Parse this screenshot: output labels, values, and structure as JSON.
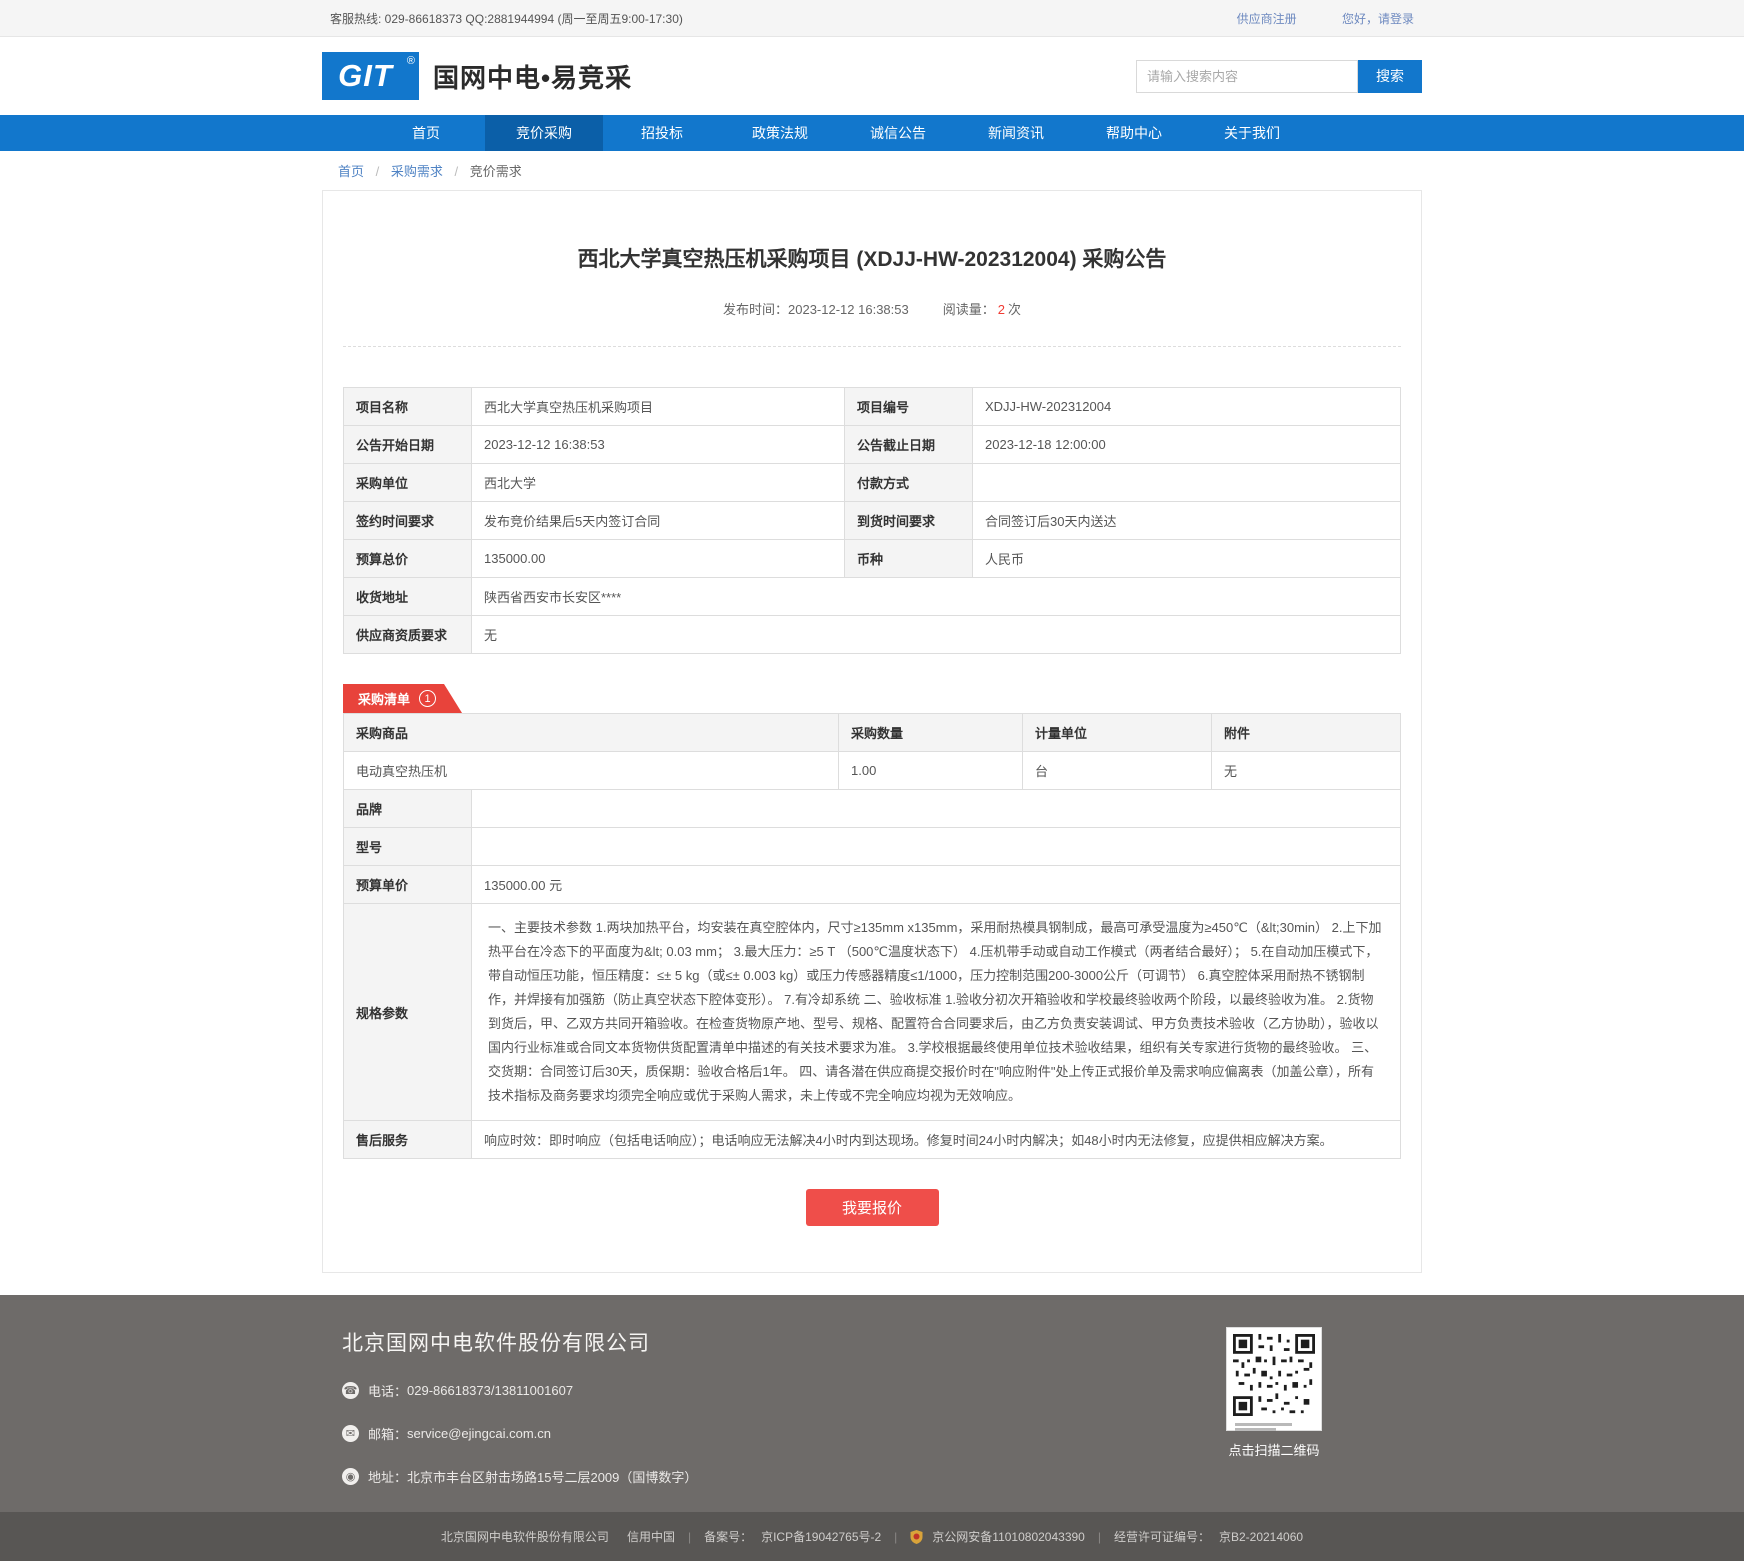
{
  "topbar": {
    "hotline": "客服热线: 029-86618373 QQ:2881944994 (周一至周五9:00-17:30)",
    "register_link": "供应商注册",
    "login_link": "您好，请登录"
  },
  "header": {
    "logo_text": "GIT",
    "logo_reg": "®",
    "site_name": "国网中电•易竞采",
    "search": {
      "placeholder": "请输入搜索内容",
      "button_label": "搜索"
    }
  },
  "nav": {
    "items": [
      {
        "label": "首页",
        "active": false
      },
      {
        "label": "竞价采购",
        "active": true
      },
      {
        "label": "招投标",
        "active": false
      },
      {
        "label": "政策法规",
        "active": false
      },
      {
        "label": "诚信公告",
        "active": false
      },
      {
        "label": "新闻资讯",
        "active": false
      },
      {
        "label": "帮助中心",
        "active": false
      },
      {
        "label": "关于我们",
        "active": false
      }
    ]
  },
  "breadcrumb": {
    "home": "首页",
    "level1": "采购需求",
    "current": "竞价需求",
    "separator": "/"
  },
  "notice": {
    "title": "西北大学真空热压机采购项目 (XDJJ-HW-202312004) 采购公告",
    "publish_label": "发布时间：",
    "publish_time": "2023-12-12 16:38:53",
    "views_label": "阅读量：",
    "views_value": "2",
    "views_unit": "次"
  },
  "info_table": {
    "rows": [
      {
        "label1": "项目名称",
        "value1": "西北大学真空热压机采购项目",
        "label2": "项目编号",
        "value2": "XDJJ-HW-202312004"
      },
      {
        "label1": "公告开始日期",
        "value1": "2023-12-12 16:38:53",
        "label2": "公告截止日期",
        "value2": "2023-12-18 12:00:00"
      },
      {
        "label1": "采购单位",
        "value1": "西北大学",
        "label2": "付款方式",
        "value2": ""
      },
      {
        "label1": "签约时间要求",
        "value1": "发布竞价结果后5天内签订合同",
        "label2": "到货时间要求",
        "value2": "合同签订后30天内送达"
      },
      {
        "label1": "预算总价",
        "value1": "135000.00",
        "label2": "币种",
        "value2": "人民币"
      },
      {
        "label1": "收货地址",
        "value1": "陕西省西安市长安区****"
      },
      {
        "label1": "供应商资质要求",
        "value1": "无"
      }
    ]
  },
  "purchase_list": {
    "tag_label": "采购清单",
    "tag_count": "1",
    "headers": [
      "采购商品",
      "采购数量",
      "计量单位",
      "附件"
    ],
    "item": {
      "name": "电动真空热压机",
      "quantity": "1.00",
      "unit": "台",
      "attachment": "无"
    },
    "details": [
      {
        "label": "品牌",
        "value": ""
      },
      {
        "label": "型号",
        "value": ""
      },
      {
        "label": "预算单价",
        "value": "135000.00 元"
      },
      {
        "label": "规格参数",
        "value": "一、主要技术参数 1.两块加热平台，均安装在真空腔体内，尺寸≥135mm x135mm，采用耐热模具钢制成，最高可承受温度为≥450℃（&lt;30min） 2.上下加热平台在冷态下的平面度为&lt; 0.03 mm； 3.最大压力：≥5 T （500℃温度状态下） 4.压机带手动或自动工作模式（两者结合最好）； 5.在自动加压模式下，带自动恒压功能，恒压精度：≤± 5 kg（或≤± 0.003 kg）或压力传感器精度≤1/1000，压力控制范围200-3000公斤（可调节） 6.真空腔体采用耐热不锈钢制作，并焊接有加强筋（防止真空状态下腔体变形）。 7.有冷却系统 二、验收标准 1.验收分初次开箱验收和学校最终验收两个阶段，以最终验收为准。 2.货物到货后，甲、乙双方共同开箱验收。在检查货物原产地、型号、规格、配置符合合同要求后，由乙方负责安装调试、甲方负责技术验收（乙方协助），验收以国内行业标准或合同文本货物供货配置清单中描述的有关技术要求为准。 3.学校根据最终使用单位技术验收结果，组织有关专家进行货物的最终验收。 三、交货期：合同签订后30天，质保期：验收合格后1年。 四、请各潜在供应商提交报价时在\"响应附件\"处上传正式报价单及需求响应偏离表（加盖公章），所有技术指标及商务要求均须完全响应或优于采购人需求，未上传或不完全响应均视为无效响应。"
      },
      {
        "label": "售后服务",
        "value": "响应时效：即时响应（包括电话响应）；电话响应无法解决4小时内到达现场。修复时间24小时内解决；如48小时内无法修复，应提供相应解决方案。"
      }
    ]
  },
  "quote_button_label": "我要报价",
  "footer": {
    "company": "北京国网中电软件股份有限公司",
    "phone_label": "电话：",
    "phone": "029-86618373/13811001607",
    "email_label": "邮箱：",
    "email": "service@ejingcai.com.cn",
    "address_label": "地址：",
    "address": "北京市丰台区射击场路15号二层2009（国博数字）",
    "qr_caption": "点击扫描二维码"
  },
  "bottom_bar": {
    "company": "北京国网中电软件股份有限公司",
    "credit": "信用中国",
    "icp_label": "备案号：",
    "icp": "京ICP备19042765号-2",
    "police": "京公网安备11010802043390",
    "license_label": "经营许可证编号：",
    "license": "京B2-20214060"
  },
  "colors": {
    "primary_blue": "#1277cc",
    "active_nav_blue": "#0b5fa8",
    "ribbon_red": "#e8433b",
    "price_red": "#f03c34",
    "button_red": "#ef4e4a",
    "footer_gray": "#6e6b69",
    "bottombar_gray": "#585654"
  }
}
